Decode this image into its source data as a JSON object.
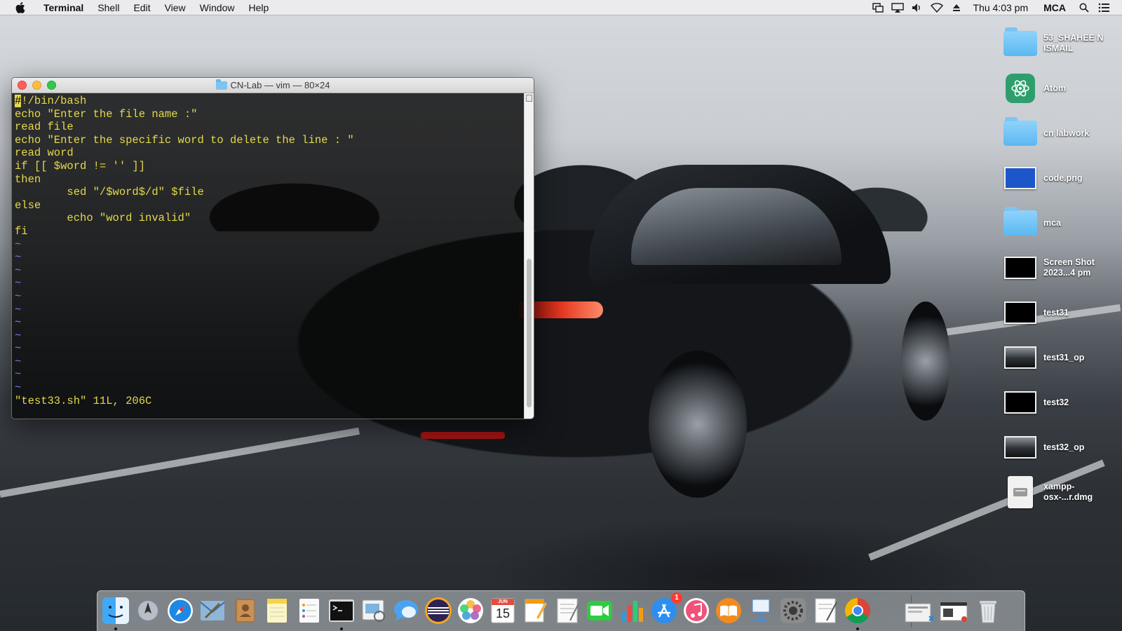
{
  "menubar": {
    "app_name": "Terminal",
    "items": [
      "Shell",
      "Edit",
      "View",
      "Window",
      "Help"
    ],
    "clock": "Thu 4:03 pm",
    "user": "MCA"
  },
  "terminal": {
    "title": "CN-Lab — vim — 80×24",
    "lines": [
      "#!/bin/bash",
      "echo \"Enter the file name :\"",
      "read file",
      "echo \"Enter the specific word to delete the line : \"",
      "read word",
      "if [[ $word != '' ]]",
      "then",
      "        sed \"/$word$/d\" $file",
      "else",
      "        echo \"word invalid\"",
      "fi"
    ],
    "first_line_rest": "!/bin/bash",
    "cursor_char": "#",
    "tilde": "~",
    "status_line": "\"test33.sh\" 11L, 206C"
  },
  "desktop": {
    "items": [
      {
        "label": "53_SHAHEE N ISMAIL",
        "icon": "folder-icon"
      },
      {
        "label": "Atom",
        "icon": "atom-app-icon"
      },
      {
        "label": "cn labwork",
        "icon": "folder-icon"
      },
      {
        "label": "code.png",
        "icon": "image-thumbnail-icon"
      },
      {
        "label": "mca",
        "icon": "folder-icon"
      },
      {
        "label": "Screen Shot 2023...4 pm",
        "icon": "screenshot-thumbnail-icon"
      },
      {
        "label": "test31",
        "icon": "screenshot-thumbnail-icon"
      },
      {
        "label": "test31_op",
        "icon": "screenshot-thumbnail-icon"
      },
      {
        "label": "test32",
        "icon": "screenshot-thumbnail-icon"
      },
      {
        "label": "test32_op",
        "icon": "screenshot-thumbnail-icon"
      },
      {
        "label": "xampp-osx-...r.dmg",
        "icon": "disk-image-icon"
      }
    ]
  },
  "dock": {
    "apps": [
      "finder",
      "launchpad",
      "safari",
      "mail",
      "contacts",
      "notes",
      "reminders",
      "terminal",
      "preview",
      "messages",
      "eclipse",
      "photos",
      "calendar",
      "pages",
      "textedit",
      "facetime",
      "numbers",
      "app-store",
      "itunes",
      "ibooks",
      "keynote",
      "system-preferences",
      "textedit-2",
      "chrome",
      "downloads-stack",
      "documents-stack",
      "trash"
    ],
    "calendar_month": "JUN",
    "calendar_day": "15",
    "app_store_badge": "1"
  }
}
